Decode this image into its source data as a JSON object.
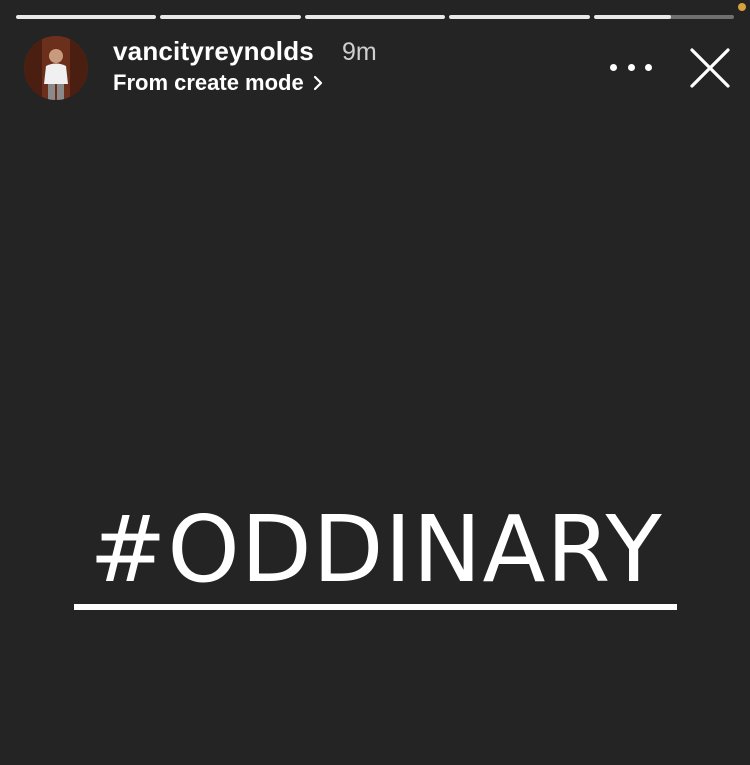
{
  "story": {
    "username": "vancityreynolds",
    "time_ago": "9m",
    "subline": "From create mode",
    "progress": [
      1,
      1,
      1,
      1,
      0.55
    ],
    "hashtag": "#ODDINARY"
  },
  "icons": {
    "more": "more-dots-icon",
    "close": "close-icon",
    "chevron": "chevron-right-icon"
  },
  "colors": {
    "background": "#242424",
    "status_dot": "#d9a13a"
  }
}
